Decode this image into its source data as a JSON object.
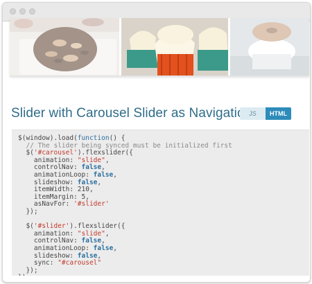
{
  "colors": {
    "heading": "#2f6d8a",
    "tab_active": "#2d8cba",
    "tab_inactive": "#dcebf2",
    "code_bg": "#ececec"
  },
  "window": {
    "controls": [
      "close",
      "minimize",
      "zoom"
    ]
  },
  "carousel": {
    "slides": [
      {
        "name": "chocolate-cookie-slide"
      },
      {
        "name": "cupcakes-slide"
      },
      {
        "name": "donut-slide"
      }
    ]
  },
  "section": {
    "title": "Slider with Carousel Slider as Navigation",
    "tabs": [
      {
        "label": "JS",
        "active": false
      },
      {
        "label": "HTML",
        "active": true
      }
    ]
  },
  "code": {
    "lines": [
      [
        {
          "t": "$(window).load(",
          "c": "plain"
        },
        {
          "t": "function",
          "c": "keyword"
        },
        {
          "t": "() {",
          "c": "plain"
        }
      ],
      [
        {
          "t": "  // The slider being synced must be initialized first",
          "c": "comment"
        }
      ],
      [
        {
          "t": "  $(",
          "c": "plain"
        },
        {
          "t": "'#carousel'",
          "c": "string"
        },
        {
          "t": ").flexslider({",
          "c": "plain"
        }
      ],
      [
        {
          "t": "    animation: ",
          "c": "plain"
        },
        {
          "t": "\"slide\"",
          "c": "string"
        },
        {
          "t": ",",
          "c": "plain"
        }
      ],
      [
        {
          "t": "    controlNav: ",
          "c": "plain"
        },
        {
          "t": "false",
          "c": "bool"
        },
        {
          "t": ",",
          "c": "plain"
        }
      ],
      [
        {
          "t": "    animationLoop: ",
          "c": "plain"
        },
        {
          "t": "false",
          "c": "bool"
        },
        {
          "t": ",",
          "c": "plain"
        }
      ],
      [
        {
          "t": "    slideshow: ",
          "c": "plain"
        },
        {
          "t": "false",
          "c": "bool"
        },
        {
          "t": ",",
          "c": "plain"
        }
      ],
      [
        {
          "t": "    itemWidth: 210,",
          "c": "plain"
        }
      ],
      [
        {
          "t": "    itemMargin: 5,",
          "c": "plain"
        }
      ],
      [
        {
          "t": "    asNavFor: ",
          "c": "plain"
        },
        {
          "t": "'#slider'",
          "c": "string"
        }
      ],
      [
        {
          "t": "  });",
          "c": "plain"
        }
      ],
      [
        {
          "t": "",
          "c": "plain"
        }
      ],
      [
        {
          "t": "  $(",
          "c": "plain"
        },
        {
          "t": "'#slider'",
          "c": "string"
        },
        {
          "t": ").flexslider({",
          "c": "plain"
        }
      ],
      [
        {
          "t": "    animation: ",
          "c": "plain"
        },
        {
          "t": "\"slide\"",
          "c": "string"
        },
        {
          "t": ",",
          "c": "plain"
        }
      ],
      [
        {
          "t": "    controlNav: ",
          "c": "plain"
        },
        {
          "t": "false",
          "c": "bool"
        },
        {
          "t": ",",
          "c": "plain"
        }
      ],
      [
        {
          "t": "    animationLoop: ",
          "c": "plain"
        },
        {
          "t": "false",
          "c": "bool"
        },
        {
          "t": ",",
          "c": "plain"
        }
      ],
      [
        {
          "t": "    slideshow: ",
          "c": "plain"
        },
        {
          "t": "false",
          "c": "bool"
        },
        {
          "t": ",",
          "c": "plain"
        }
      ],
      [
        {
          "t": "    sync: ",
          "c": "plain"
        },
        {
          "t": "\"#carousel\"",
          "c": "string"
        }
      ],
      [
        {
          "t": "  });",
          "c": "plain"
        }
      ],
      [
        {
          "t": "});",
          "c": "plain"
        }
      ]
    ]
  }
}
